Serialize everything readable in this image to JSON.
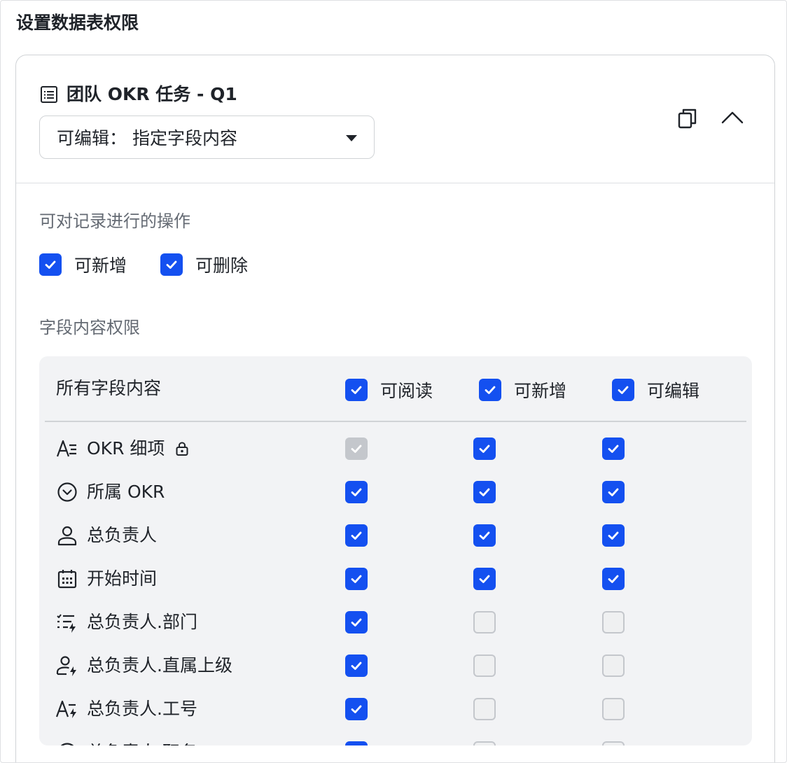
{
  "page": {
    "title": "设置数据表权限"
  },
  "card": {
    "table_name": "团队 OKR 任务 - Q1",
    "permission_select": {
      "value": "可编辑：  指定字段内容"
    },
    "icons": {
      "table": "table-icon",
      "copy": "copy-icon",
      "collapse": "chevron-up-icon"
    }
  },
  "record_ops": {
    "label": "可对记录进行的操作",
    "items": [
      {
        "label": "可新增",
        "checked": true
      },
      {
        "label": "可删除",
        "checked": true
      }
    ]
  },
  "field_perms": {
    "label": "字段内容权限",
    "all_label": "所有字段内容",
    "columns": [
      {
        "label": "可阅读",
        "checked": true
      },
      {
        "label": "可新增",
        "checked": true
      },
      {
        "label": "可编辑",
        "checked": true
      }
    ],
    "rows": [
      {
        "name": "OKR 细项",
        "icon": "text-field-icon",
        "locked": true,
        "read": "disabled",
        "add": "on",
        "edit": "on"
      },
      {
        "name": "所属 OKR",
        "icon": "single-select-icon",
        "locked": false,
        "read": "on",
        "add": "on",
        "edit": "on"
      },
      {
        "name": "总负责人",
        "icon": "person-icon",
        "locked": false,
        "read": "on",
        "add": "on",
        "edit": "on"
      },
      {
        "name": "开始时间",
        "icon": "calendar-icon",
        "locked": false,
        "read": "on",
        "add": "on",
        "edit": "on"
      },
      {
        "name": "总负责人.部门",
        "icon": "lookup-list-icon",
        "locked": false,
        "read": "on",
        "add": "off",
        "edit": "off"
      },
      {
        "name": "总负责人.直属上级",
        "icon": "lookup-person-icon",
        "locked": false,
        "read": "on",
        "add": "off",
        "edit": "off"
      },
      {
        "name": "总负责人.工号",
        "icon": "lookup-text-icon",
        "locked": false,
        "read": "on",
        "add": "off",
        "edit": "off"
      },
      {
        "name": "总负责人.职务",
        "icon": "single-select-icon",
        "locked": false,
        "read": "on",
        "add": "off",
        "edit": "off"
      }
    ]
  },
  "colors": {
    "accent": "#1450f0",
    "panel_bg": "#f2f3f5",
    "disabled": "#c4c7cc"
  }
}
